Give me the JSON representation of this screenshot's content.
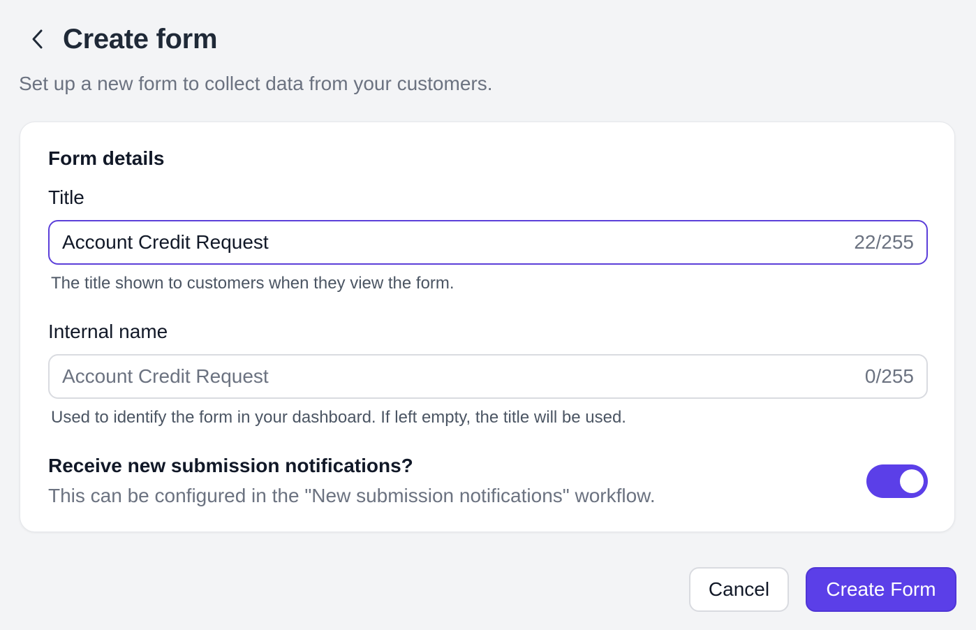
{
  "header": {
    "back_icon": "chevron-left-icon",
    "title": "Create form",
    "subtitle": "Set up a new form to collect data from your customers."
  },
  "card": {
    "section_title": "Form details",
    "title_field": {
      "label": "Title",
      "value": "Account Credit Request",
      "counter": "22/255",
      "helper": "The title shown to customers when they view the form."
    },
    "internal_name_field": {
      "label": "Internal name",
      "value": "",
      "placeholder": "Account Credit Request",
      "counter": "0/255",
      "helper": "Used to identify the form in your dashboard. If left empty, the title will be used."
    },
    "notifications": {
      "title": "Receive new submission notifications?",
      "description": "This can be configured in the \"New submission notifications\" workflow.",
      "enabled": true
    }
  },
  "footer": {
    "cancel_label": "Cancel",
    "create_label": "Create Form"
  },
  "colors": {
    "accent": "#5b3fe8",
    "background": "#f3f4f6"
  }
}
